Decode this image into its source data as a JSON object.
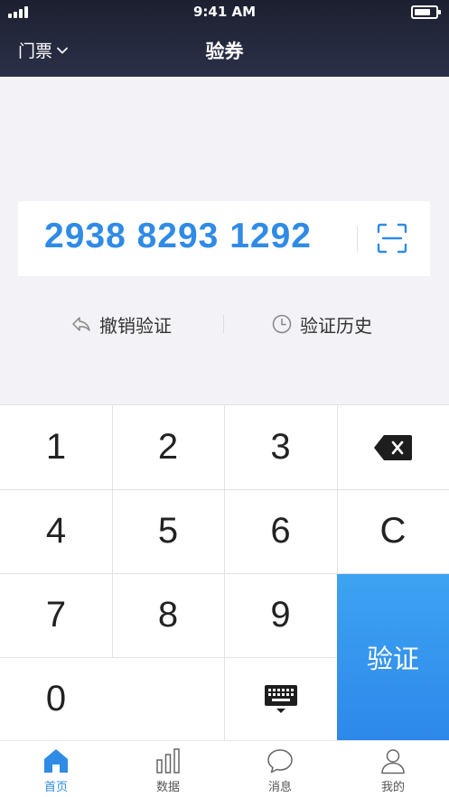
{
  "status_bar": {
    "time": "9:41 AM"
  },
  "nav": {
    "ticket_type": "门票",
    "title": "验券"
  },
  "code": {
    "value": "2938 8293 1292"
  },
  "actions": {
    "revoke_label": "撤销验证",
    "history_label": "验证历史"
  },
  "keypad": {
    "k1": "1",
    "k2": "2",
    "k3": "3",
    "k4": "4",
    "k5": "5",
    "k6": "6",
    "k7": "7",
    "k8": "8",
    "k9": "9",
    "k0": "0",
    "clear": "C",
    "verify": "验证"
  },
  "tabs": [
    {
      "label": "首页",
      "icon": "home-icon",
      "active": true
    },
    {
      "label": "数据",
      "icon": "bar-chart-icon"
    },
    {
      "label": "消息",
      "icon": "chat-bubble-icon"
    },
    {
      "label": "我的",
      "icon": "user-icon"
    }
  ],
  "colors": {
    "accent": "#2f8be6",
    "header": "#23283a",
    "verify_button": "#3596ee"
  }
}
